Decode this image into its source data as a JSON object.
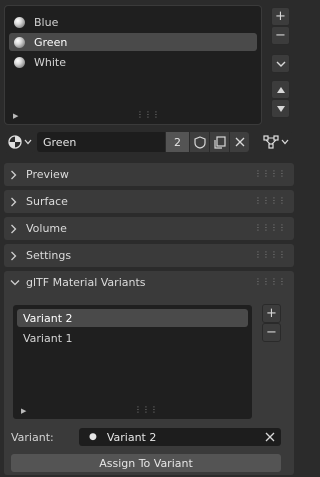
{
  "material_slots": {
    "items": [
      {
        "label": "Blue",
        "active": false
      },
      {
        "label": "Green",
        "active": true
      },
      {
        "label": "White",
        "active": false
      }
    ],
    "add_symbol": "+",
    "remove_symbol": "−",
    "menu_symbol": "⌄"
  },
  "material": {
    "name": "Green",
    "users": "2"
  },
  "panels": {
    "preview": "Preview",
    "surface": "Surface",
    "volume": "Volume",
    "settings": "Settings",
    "gltf_variants": "glTF Material Variants"
  },
  "variants": {
    "items": [
      {
        "label": "Variant 2",
        "active": true
      },
      {
        "label": "Variant 1",
        "active": false
      }
    ],
    "field_label": "Variant:",
    "field_value": "Variant 2",
    "assign_button": "Assign To Variant",
    "add_symbol": "+",
    "remove_symbol": "−"
  },
  "colors": {
    "background": "#2b2b2b",
    "list_bg": "#1f1f1f",
    "active_row": "#4a4a4a",
    "panel_header": "#3a3a3a"
  }
}
